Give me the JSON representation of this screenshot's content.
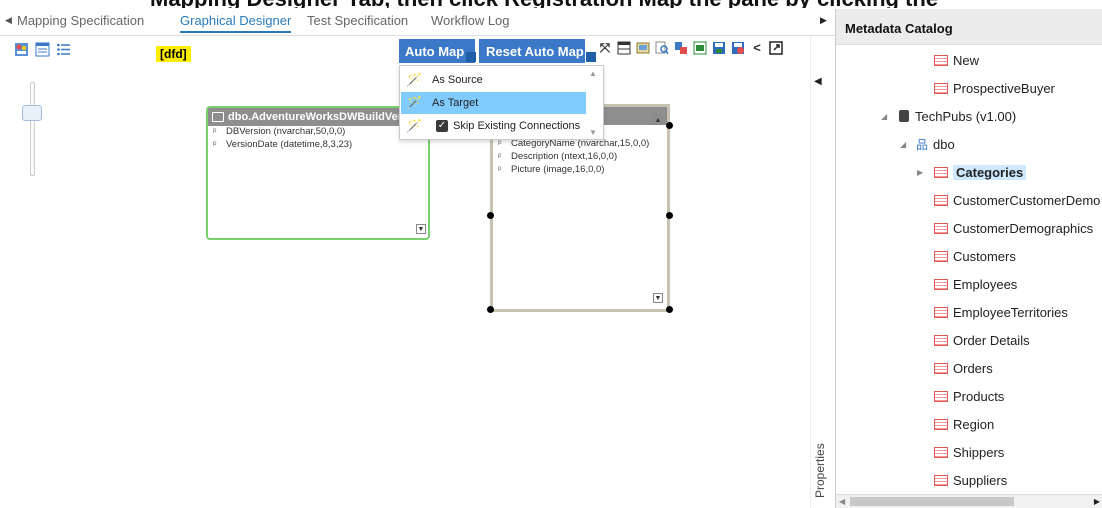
{
  "page_header_cut": "Mapping Designer Tab, then click Registration Map the pane by clicking the",
  "tabs": {
    "items": [
      {
        "label": "Mapping Specification"
      },
      {
        "label": "Graphical Designer"
      },
      {
        "label": "Test Specification"
      },
      {
        "label": "Workflow Log"
      }
    ],
    "active": "Graphical Designer"
  },
  "toolbar": {
    "tag": "[dfd]",
    "auto_map": "Auto Map",
    "reset_auto_map": "Reset Auto Map"
  },
  "auto_map_menu": {
    "items": [
      {
        "label": "As Source"
      },
      {
        "label": "As Target"
      },
      {
        "label": "Skip Existing Connections"
      }
    ],
    "highlighted": "As Target",
    "skip_checked": true
  },
  "source_entity": {
    "title": "dbo.AdventureWorksDWBuildVersion",
    "columns": [
      {
        "label": "DBVersion (nvarchar,50,0,0)"
      },
      {
        "label": "VersionDate (datetime,8,3,23)"
      }
    ]
  },
  "target_entity": {
    "partial_row": "0)",
    "columns": [
      {
        "label": "CategoryName (nvarchar,15,0,0)"
      },
      {
        "label": "Description (ntext,16,0,0)"
      },
      {
        "label": "Picture (image,16,0,0)"
      }
    ]
  },
  "properties_label": "Properties",
  "metadata_catalog": {
    "title": "Metadata Catalog",
    "tree": {
      "new": "New",
      "prospective_buyer": "ProspectiveBuyer",
      "techpubs": "TechPubs (v1.00)",
      "dbo": "dbo",
      "categories": "Categories",
      "tables": [
        {
          "label": "CustomerCustomerDemo"
        },
        {
          "label": "CustomerDemographics"
        },
        {
          "label": "Customers"
        },
        {
          "label": "Employees"
        },
        {
          "label": "EmployeeTerritories"
        },
        {
          "label": "Order Details"
        },
        {
          "label": "Orders"
        },
        {
          "label": "Products"
        },
        {
          "label": "Region"
        },
        {
          "label": "Shippers"
        },
        {
          "label": "Suppliers"
        }
      ]
    }
  },
  "colors": {
    "accent": "#3b79c8",
    "tag_yellow": "#ffee00",
    "menu_highlight": "#80cbff",
    "source_border": "#79d070"
  }
}
